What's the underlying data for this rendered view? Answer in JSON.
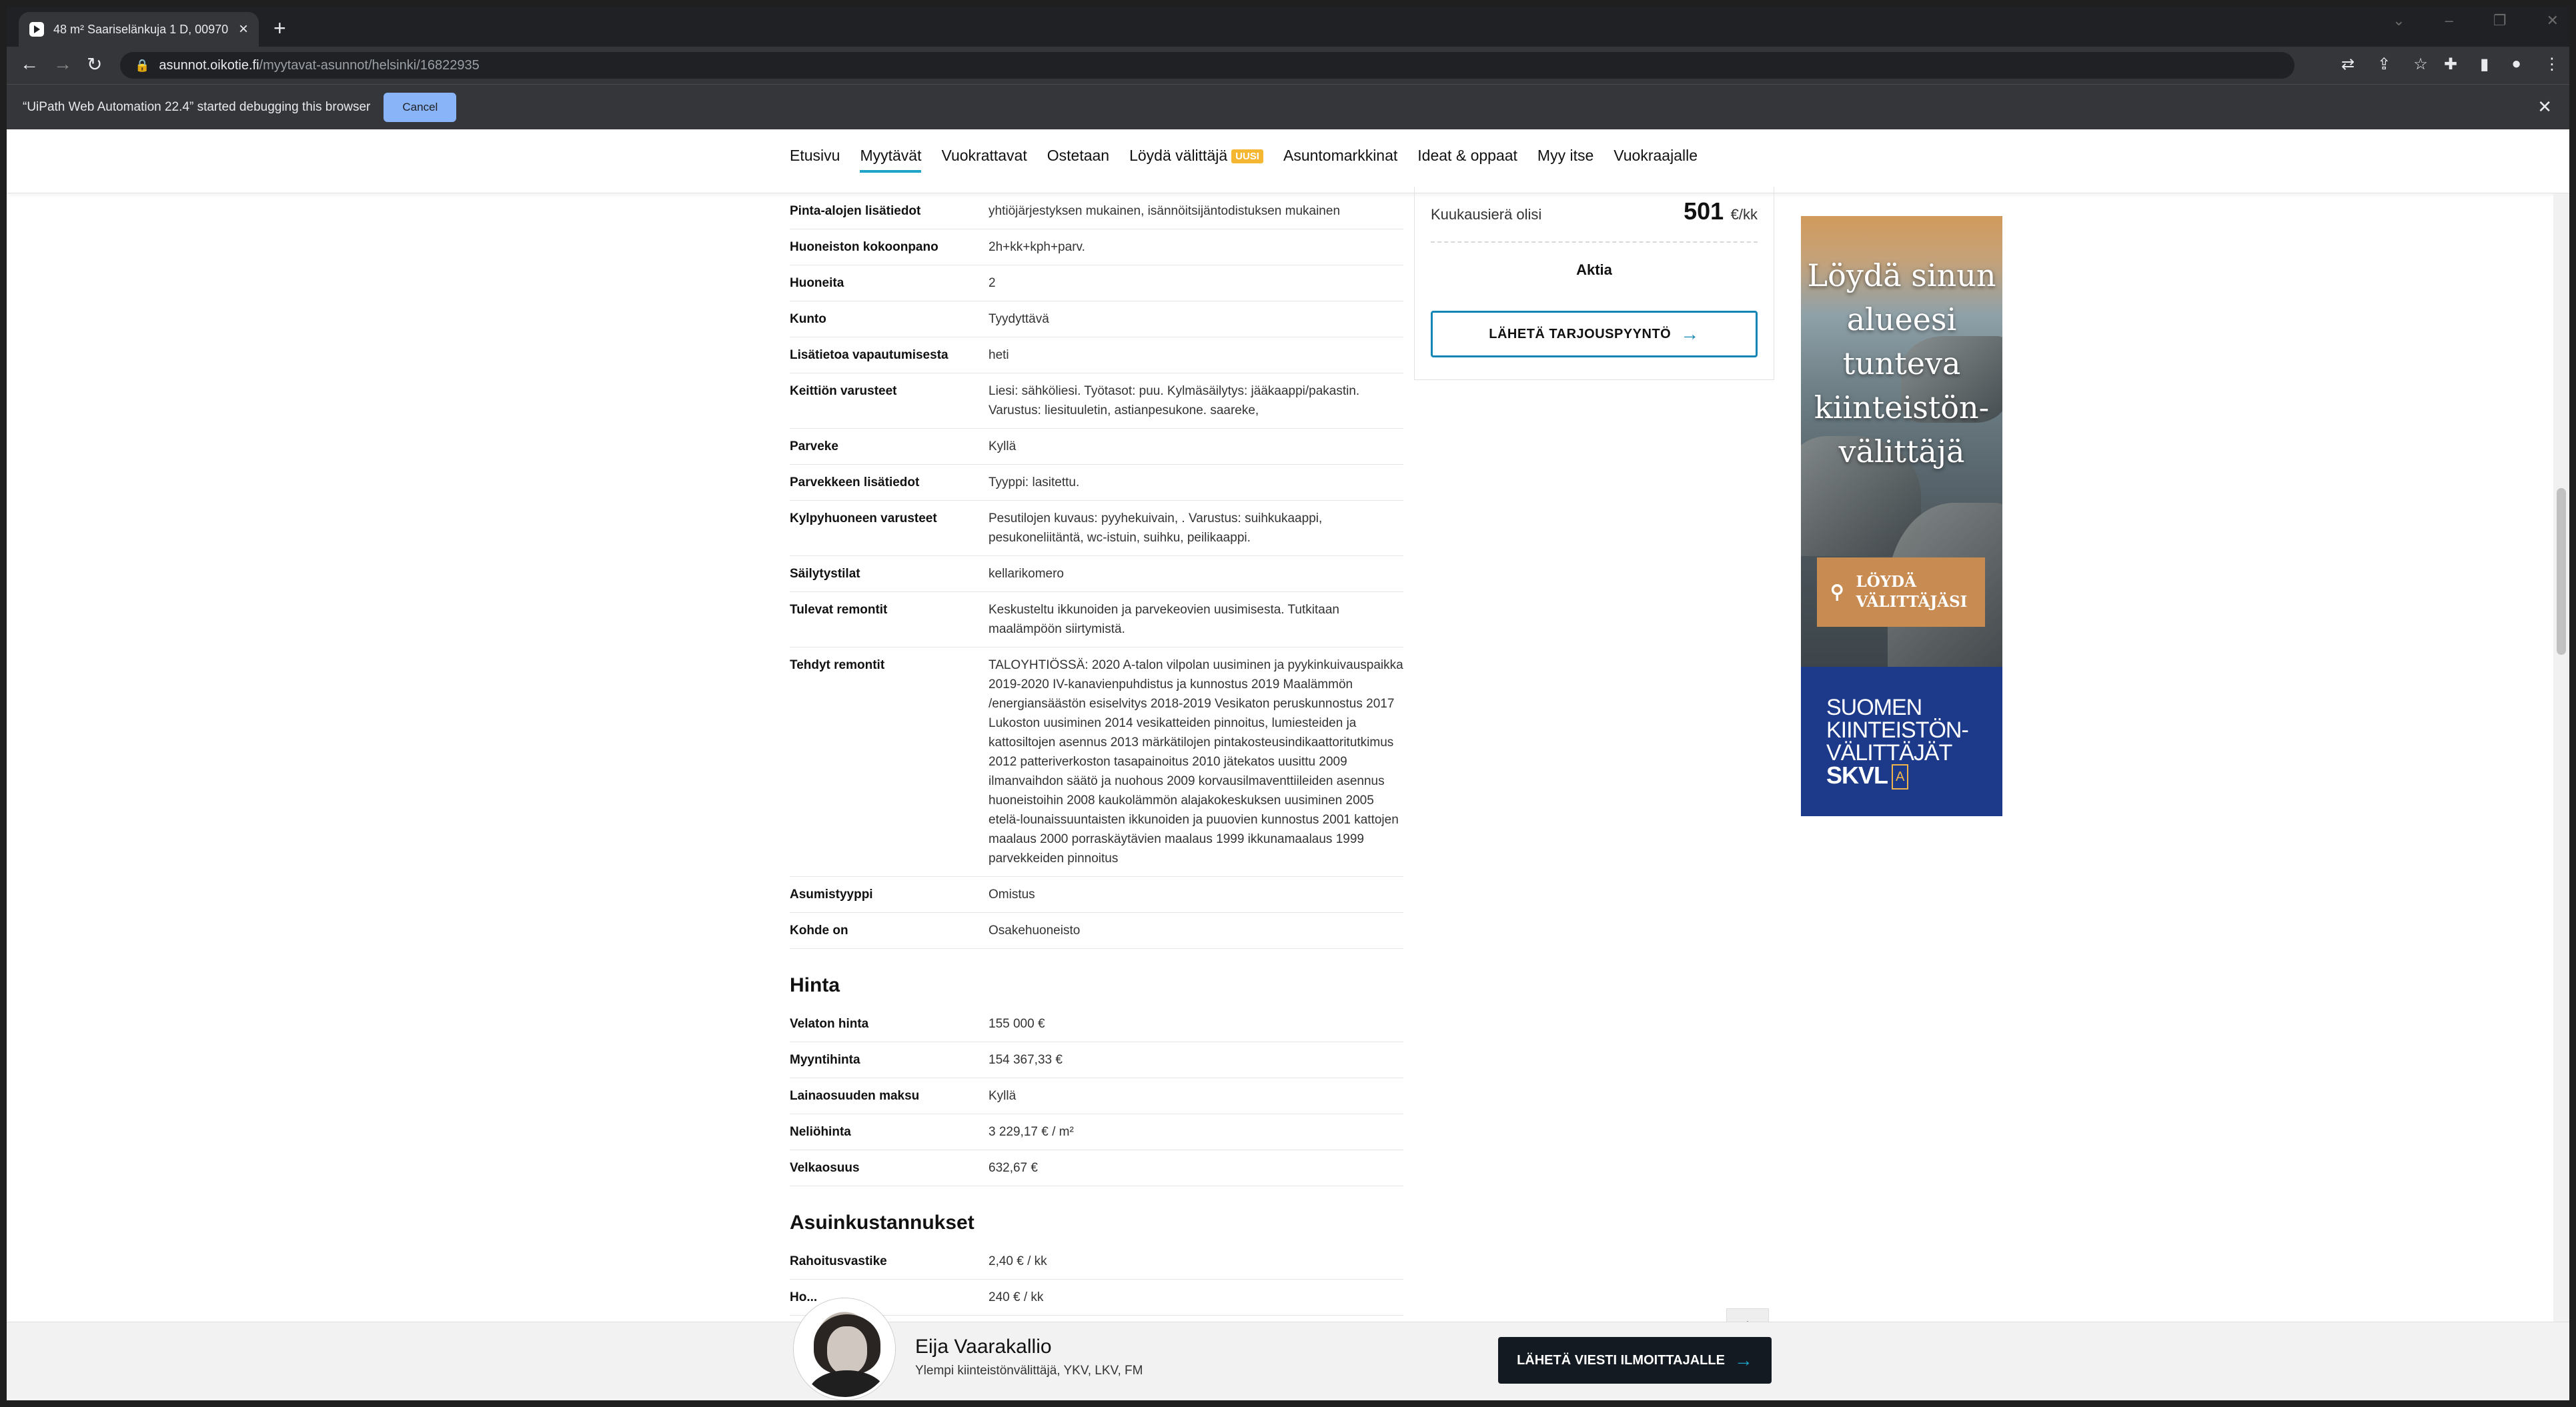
{
  "browser": {
    "tab_title": "48 m² Saariselänkuja 1 D, 00970 ...",
    "url_host": "asunnot.oikotie.fi",
    "url_path": "/myytavat-asunnot/helsinki/16822935",
    "debug_message": "“UiPath Web Automation 22.4” started debugging this browser",
    "debug_cancel": "Cancel"
  },
  "nav": {
    "items": [
      "Etusivu",
      "Myytävät",
      "Vuokrattavat",
      "Ostetaan",
      "Löydä välittäjä",
      "Asuntomarkkinat",
      "Ideat & oppaat",
      "Myy itse",
      "Vuokraajalle"
    ],
    "active": "Myytävät",
    "badge": "UUSI"
  },
  "details": [
    {
      "label": "Pinta-alojen lisätiedot",
      "value": "yhtiöjärjestyksen mukainen, isännöitsijäntodistuksen mukainen"
    },
    {
      "label": "Huoneiston kokoonpano",
      "value": "2h+kk+kph+parv."
    },
    {
      "label": "Huoneita",
      "value": "2"
    },
    {
      "label": "Kunto",
      "value": "Tyydyttävä"
    },
    {
      "label": "Lisätietoa vapautumisesta",
      "value": "heti"
    },
    {
      "label": "Keittiön varusteet",
      "value": "Liesi: sähköliesi. Työtasot: puu. Kylmäsäilytys: jääkaappi/pakastin. Varustus: liesituuletin, astianpesukone. saareke,"
    },
    {
      "label": "Parveke",
      "value": "Kyllä"
    },
    {
      "label": "Parvekkeen lisätiedot",
      "value": "Tyyppi: lasitettu."
    },
    {
      "label": "Kylpyhuoneen varusteet",
      "value": "Pesutilojen kuvaus: pyyhekuivain, . Varustus: suihkukaappi, pesukoneliitäntä, wc-istuin, suihku, peilikaappi."
    },
    {
      "label": "Säilytystilat",
      "value": "kellarikomero"
    },
    {
      "label": "Tulevat remontit",
      "value": "Keskusteltu ikkunoiden ja parvekeovien uusimisesta. Tutkitaan maalämpöön siirtymistä."
    },
    {
      "label": "Tehdyt remontit",
      "value": "TALOYHTIÖSSÄ: 2020 A-talon vilpolan uusiminen ja pyykinkuivauspaikka 2019-2020 IV-kanavienpuhdistus ja kunnostus 2019 Maalämmön /energiansäästön esiselvitys 2018-2019 Vesikaton peruskunnostus 2017 Lukoston uusiminen 2014 vesikatteiden pinnoitus, lumiesteiden ja kattosiltojen asennus 2013 märkätilojen pintakosteusindikaattoritutkimus 2012 patteriverkoston tasapainoitus 2010 jätekatos uusittu 2009 ilmanvaihdon säätö ja nuohous 2009 korvausilmaventtiileiden asennus huoneistoihin 2008 kaukolämmön alajakokeskuksen uusiminen 2005 etelä-lounaissuuntaisten ikkunoiden ja puuovien kunnostus 2001 kattojen maalaus 2000 porraskäytävien maalaus 1999 ikkunamaalaus 1999 parvekkeiden pinnoitus"
    },
    {
      "label": "Asumistyyppi",
      "value": "Omistus"
    },
    {
      "label": "Kohde on",
      "value": "Osakehuoneisto"
    }
  ],
  "price": {
    "title": "Hinta",
    "rows": [
      {
        "label": "Velaton hinta",
        "value": "155 000 €"
      },
      {
        "label": "Myyntihinta",
        "value": "154 367,33 €"
      },
      {
        "label": "Lainaosuuden maksu",
        "value": "Kyllä"
      },
      {
        "label": "Neliöhinta",
        "value": "3 229,17 € / m²"
      },
      {
        "label": "Velkaosuus",
        "value": "632,67 €"
      }
    ]
  },
  "costs": {
    "title": "Asuinkustannukset",
    "rows": [
      {
        "label": "Rahoitusvastike",
        "value": "2,40 € / kk"
      },
      {
        "label": "Ho...",
        "value": "240 € / kk"
      }
    ]
  },
  "sidebar": {
    "monthly_label": "Kuukausierä olisi",
    "monthly_amount": "501",
    "monthly_unit": "€/kk",
    "bank": "Aktia",
    "offer_button": "LÄHETÄ TARJOUSPYYNTÖ"
  },
  "ad": {
    "headline": "Löydä sinun alueesi tunteva kiinteistön-välittäjä",
    "button": "LÖYDÄ VÄLITTÄJÄSI",
    "org_line1": "SUOMEN",
    "org_line2": "KIINTEISTÖN-",
    "org_line3": "VÄLITTÄJÄT",
    "org_abbr": "SKVL",
    "org_mark": "A"
  },
  "agent": {
    "name": "Eija Vaarakallio",
    "title": "Ylempi kiinteistönvälittäjä, YKV, LKV, FM",
    "message_button": "LÄHETÄ VIESTI ILMOITTAJALLE"
  }
}
